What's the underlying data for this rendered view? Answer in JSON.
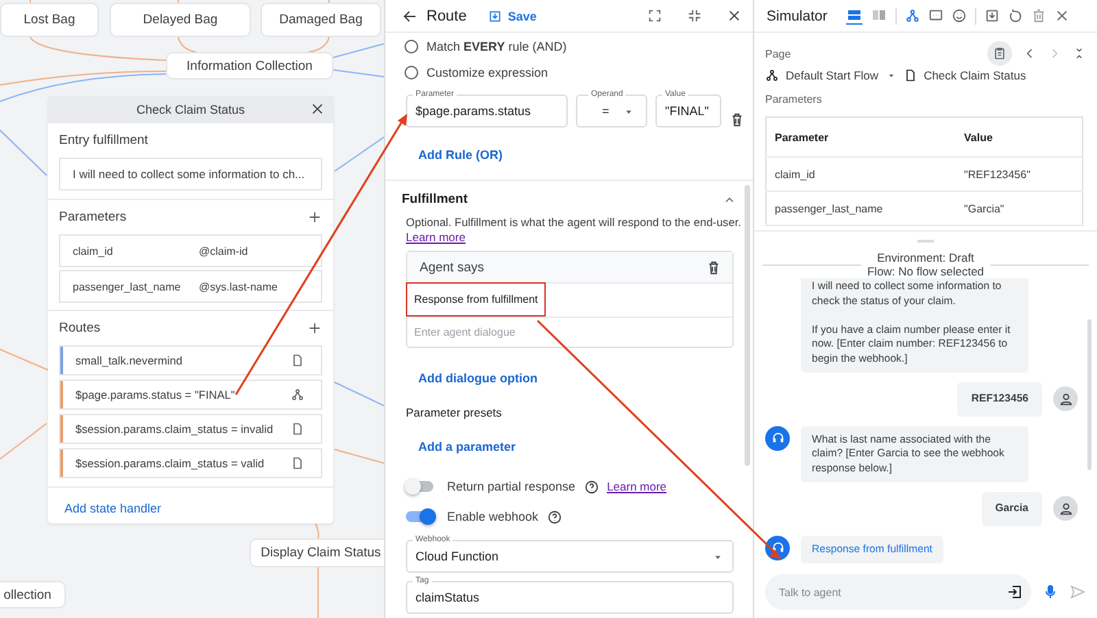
{
  "canvas": {
    "nodes": [
      {
        "label": "Lost Bag"
      },
      {
        "label": "Delayed Bag"
      },
      {
        "label": "Damaged Bag"
      },
      {
        "label": "Information Collection"
      },
      {
        "label": "Display Claim Status"
      },
      {
        "label": "ollection"
      }
    ],
    "page_card": {
      "title": "Check Claim Status",
      "entry_fulfillment": {
        "heading": "Entry fulfillment",
        "text": "I will need to collect some information to ch..."
      },
      "parameters": {
        "heading": "Parameters",
        "rows": [
          {
            "name": "claim_id",
            "entity": "@claim-id"
          },
          {
            "name": "passenger_last_name",
            "entity": "@sys.last-name"
          }
        ]
      },
      "routes": {
        "heading": "Routes",
        "items": [
          {
            "condition": "small_talk.nevermind",
            "color": "#7ba2e0",
            "kind": "page"
          },
          {
            "condition": "$page.params.status = \"FINAL\"",
            "color": "#e8a06c",
            "kind": "flow"
          },
          {
            "condition": "$session.params.claim_status = invalid",
            "color": "#e8a06c",
            "kind": "page"
          },
          {
            "condition": "$session.params.claim_status = valid",
            "color": "#e8a06c",
            "kind": "page"
          }
        ]
      },
      "add_state_handler": "Add state handler"
    }
  },
  "route_panel": {
    "title": "Route",
    "save": "Save",
    "match_options": [
      {
        "label": "Match **EVERY** rule (AND)",
        "selected": false
      },
      {
        "label": "Customize expression",
        "selected": false
      }
    ],
    "rule": {
      "parameter": {
        "label": "Parameter",
        "value": "$page.params.status"
      },
      "operand": {
        "label": "Operand",
        "value": "="
      },
      "value": {
        "label": "Value",
        "value": "\"FINAL\""
      }
    },
    "add_rule": "Add Rule (OR)",
    "fulfillment": {
      "title": "Fulfillment",
      "expanded": true,
      "description": "Optional. Fulfillment is what the agent will respond to the end-user.",
      "learn_more": "Learn more",
      "agent_says": {
        "title": "Agent says",
        "responses": [
          "Response from fulfillment"
        ],
        "placeholder": "Enter agent dialogue"
      },
      "add_dialogue": "Add dialogue option",
      "presets_title": "Parameter presets",
      "add_parameter": "Add a parameter",
      "toggles": [
        {
          "label": "Return partial response",
          "on": false,
          "link": "Learn more"
        },
        {
          "label": "Enable webhook",
          "on": true
        }
      ],
      "webhook": {
        "label": "Webhook",
        "value": "Cloud Function"
      },
      "tag": {
        "label": "Tag",
        "value": "claimStatus"
      }
    }
  },
  "simulator": {
    "title": "Simulator",
    "view_modes": [
      {
        "selected": true
      },
      {
        "selected": false
      }
    ],
    "page": {
      "label": "Page",
      "flow": "Default Start Flow",
      "page": "Check Claim Status"
    },
    "parameters": {
      "title": "Parameters",
      "columns": [
        "Parameter",
        "Value"
      ],
      "rows": [
        [
          "claim_id",
          "\"REF123456\""
        ],
        [
          "passenger_last_name",
          "\"Garcia\""
        ]
      ]
    },
    "environment": [
      "Environment: Draft",
      "Flow: No flow selected"
    ],
    "messages": [
      {
        "kind": "agent",
        "avatar": false,
        "text": "I will need to collect some information to check the status of your claim.\n\nIf you have a claim number please enter it now. [Enter claim number: REF123456 to begin the webhook.]"
      },
      {
        "kind": "user",
        "text": "REF123456"
      },
      {
        "kind": "agent",
        "avatar": true,
        "text": "What is last name associated with the claim? [Enter Garcia to see the webhook response below.]"
      },
      {
        "kind": "user",
        "text": "Garcia"
      },
      {
        "kind": "webhook",
        "avatar": true,
        "text": "Response from fulfillment"
      }
    ],
    "input": {
      "placeholder": "Talk to agent"
    }
  }
}
